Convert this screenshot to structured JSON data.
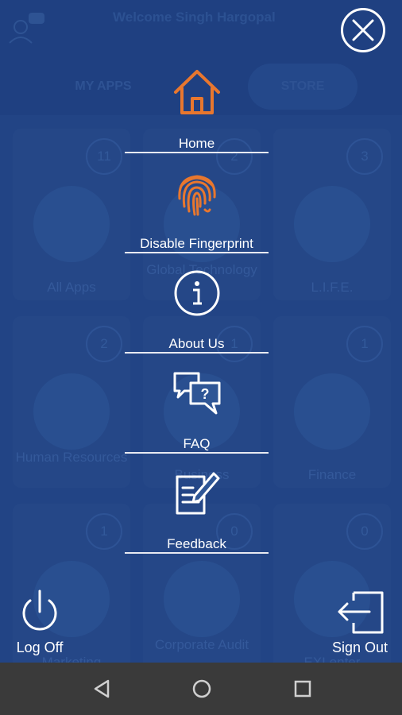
{
  "header": {
    "welcome": "Welcome Singh Hargopal"
  },
  "tabs": {
    "my_apps": "MY APPS",
    "store": "STORE"
  },
  "tiles": [
    {
      "label": "All Apps",
      "count": "11"
    },
    {
      "label": "Global Technology",
      "count": "2"
    },
    {
      "label": "L.I.F.E.",
      "count": "3"
    },
    {
      "label": "Human Resources",
      "count": "2"
    },
    {
      "label": "Business",
      "count": "1"
    },
    {
      "label": "Finance",
      "count": "1"
    },
    {
      "label": "Marketing",
      "count": "1"
    },
    {
      "label": "Corporate Audit",
      "count": "0"
    },
    {
      "label": "EXLenter",
      "count": "0"
    }
  ],
  "menu": {
    "home": "Home",
    "fingerprint": "Disable Fingerprint",
    "about": "About Us",
    "faq": "FAQ",
    "feedback": "Feedback"
  },
  "bottom": {
    "log_off": "Log Off",
    "sign_out": "Sign Out"
  },
  "colors": {
    "accent": "#e8772e",
    "background": "#2a5092"
  }
}
